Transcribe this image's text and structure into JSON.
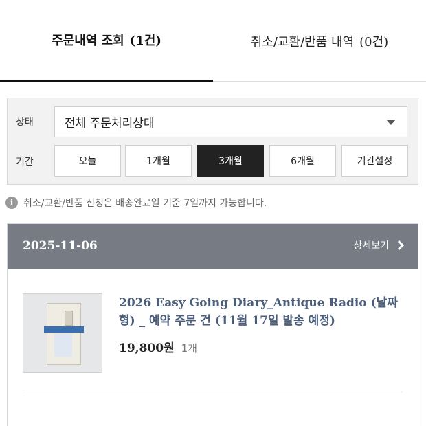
{
  "tabs": [
    {
      "label": "주문내역 조회",
      "count": "(1건)",
      "active": true
    },
    {
      "label": "취소/교환/반품 내역",
      "count": "(0건)",
      "active": false
    }
  ],
  "filter": {
    "status_label": "상태",
    "status_value": "전체 주문처리상태",
    "period_label": "기간",
    "periods": [
      "오늘",
      "1개월",
      "3개월",
      "6개월",
      "기간설정"
    ],
    "selected_period": "3개월"
  },
  "notice": {
    "icon": "info-icon",
    "text": "취소/교환/반품 신청은 배송완료일 기준 7일까지 가능합니다."
  },
  "order": {
    "date": "2025-11-06",
    "detail_label": "상세보기",
    "header_color": "#767b84",
    "product": {
      "name": "2026 Easy Going Diary_Antique Radio (날짜형) _ 예약 주문 건 (11월 17일 발송 예정)",
      "price": "19,800",
      "price_unit": "원",
      "quantity": "1개"
    }
  },
  "colors": {
    "accent": "#222222",
    "product_name": "#4a5d7a"
  }
}
